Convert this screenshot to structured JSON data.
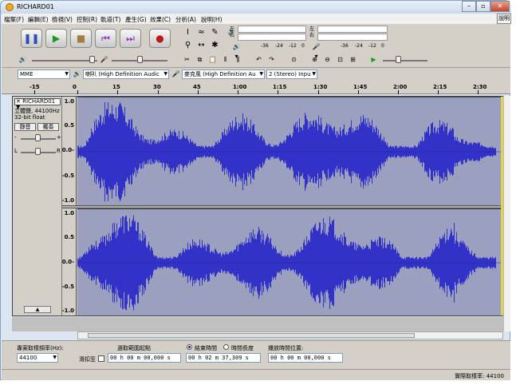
{
  "window": {
    "title": "RICHARD01",
    "help_label": "說明"
  },
  "menu": [
    "檔案(F)",
    "編輯(E)",
    "檢視(V)",
    "控制(R)",
    "軌道(T)",
    "產生(G)",
    "效果(C)",
    "分析(A)",
    "說明(H)"
  ],
  "meters": {
    "left_label": "左",
    "right_label": "右",
    "scale": [
      "-36",
      "-24",
      "-12",
      "0"
    ]
  },
  "devices": {
    "host": "MME",
    "output": "喇叭 (High Definition Audic",
    "input": "麥克風 (High Definition Au",
    "channels": "2 (Stereo) Inpu"
  },
  "ruler": [
    "-15",
    "0",
    "15",
    "30",
    "45",
    "1:00",
    "1:15",
    "1:30",
    "1:45",
    "2:00",
    "2:15",
    "2:30"
  ],
  "track": {
    "name": "RICHARD01",
    "info_line1": "立體聲, 44100Hz",
    "info_line2": "32-bit float",
    "mute_label": "靜音",
    "solo_label": "獨奏",
    "gain_minus": "-",
    "gain_plus": "+",
    "pan_left": "L",
    "pan_right": "R",
    "axis": [
      "1.0",
      "0.5",
      "0.0-",
      "-0.5",
      "-1.0"
    ]
  },
  "selection": {
    "rate_label": "專案取樣頻率(Hz):",
    "rate_value": "44100",
    "snap_label": "滑扣至",
    "start_label": "選取範圍起點",
    "start_value": "00 h 00 m 00,000 s",
    "end_radio_label": "結束時間",
    "length_radio_label": "時間長度",
    "end_value": "00 h 02 m 37,309 s",
    "pos_label": "播放時間位置:",
    "pos_value": "00 h 00 m 00,000 s"
  },
  "status": {
    "actual_rate": "實際取樣率: 44100"
  },
  "colors": {
    "wave": "#3232c8",
    "wave_bg": "#9ba0be",
    "accent_yellow": "#e0d34a"
  }
}
